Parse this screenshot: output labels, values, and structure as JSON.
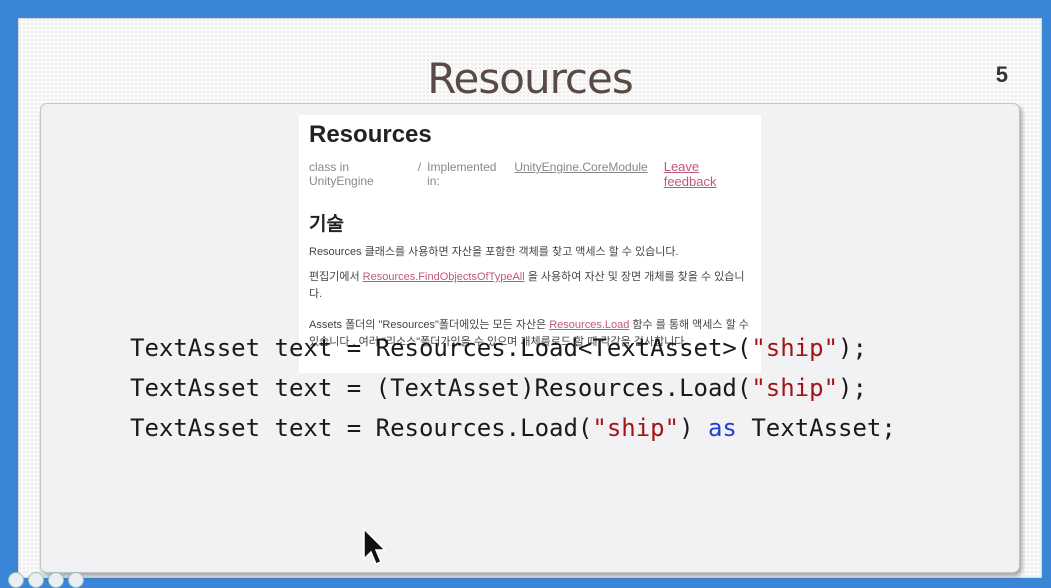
{
  "slide": {
    "title": "Resources",
    "page_number": "5"
  },
  "doc": {
    "title": "Resources",
    "meta_class": "class in UnityEngine",
    "meta_sep": "/",
    "meta_impl_label": "Implemented in:",
    "meta_impl_link": "UnityEngine.CoreModule",
    "feedback": "Leave feedback",
    "section_heading": "기술",
    "p1": "Resources 클래스를 사용하면 자산을 포함한 객체를 찾고 액세스 할 수 있습니다.",
    "p2_pre": "편집기에서 ",
    "p2_link": "Resources.FindObjectsOfTypeAll",
    "p2_post": " 을 사용하여 자산 및 장면 개체를 찾을 수 있습니다.",
    "p3_pre": "Assets 폴더의 \"Resources\"폴더에있는 모든 자산은 ",
    "p3_link": "Resources.Load",
    "p3_post": " 함수 를 통해 액세스 할 수 있습니다 . 여러 \"리소스\"폴더가있을 수 있으며 개체를로드 할 때 각각을 검사합니다."
  },
  "code": {
    "line1_a": "TextAsset text = Resources.Load<TextAsset>(",
    "line1_s": "\"ship\"",
    "line1_b": ");",
    "line2_a": "TextAsset text = (TextAsset)Resources.Load(",
    "line2_s": "\"ship\"",
    "line2_b": ");",
    "line3_a": "TextAsset text = Resources.Load(",
    "line3_s": "\"ship\"",
    "line3_b": ") ",
    "line3_kw": "as",
    "line3_c": " TextAsset;"
  },
  "colors": {
    "frame": "#3a86d6",
    "title_text": "#5a4a45",
    "string": "#a31515",
    "keyword": "#1f3fd6",
    "doc_link": "#c0587c"
  }
}
